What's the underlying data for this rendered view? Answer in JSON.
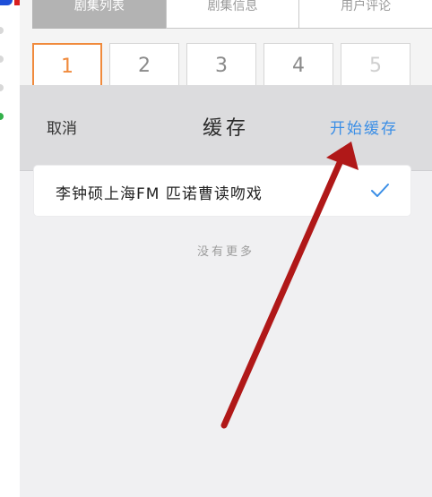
{
  "background": {
    "tabs": [
      {
        "label": "剧集列表",
        "active": true
      },
      {
        "label": "剧集信息",
        "active": false
      },
      {
        "label": "用户评论",
        "active": false
      }
    ],
    "episodes": [
      "1",
      "2",
      "3",
      "4",
      "5"
    ],
    "selected_episode": "1"
  },
  "sheet": {
    "cancel_label": "取消",
    "title": "缓存",
    "start_label": "开始缓存",
    "items": [
      {
        "title": "李钟硕上海FM 匹诺曹读吻戏",
        "checked": true
      }
    ],
    "footer_text": "没有更多"
  },
  "colors": {
    "accent": "#3a8ee6",
    "selected_episode": "#f08a3c",
    "annotation_arrow": "#b01818"
  }
}
